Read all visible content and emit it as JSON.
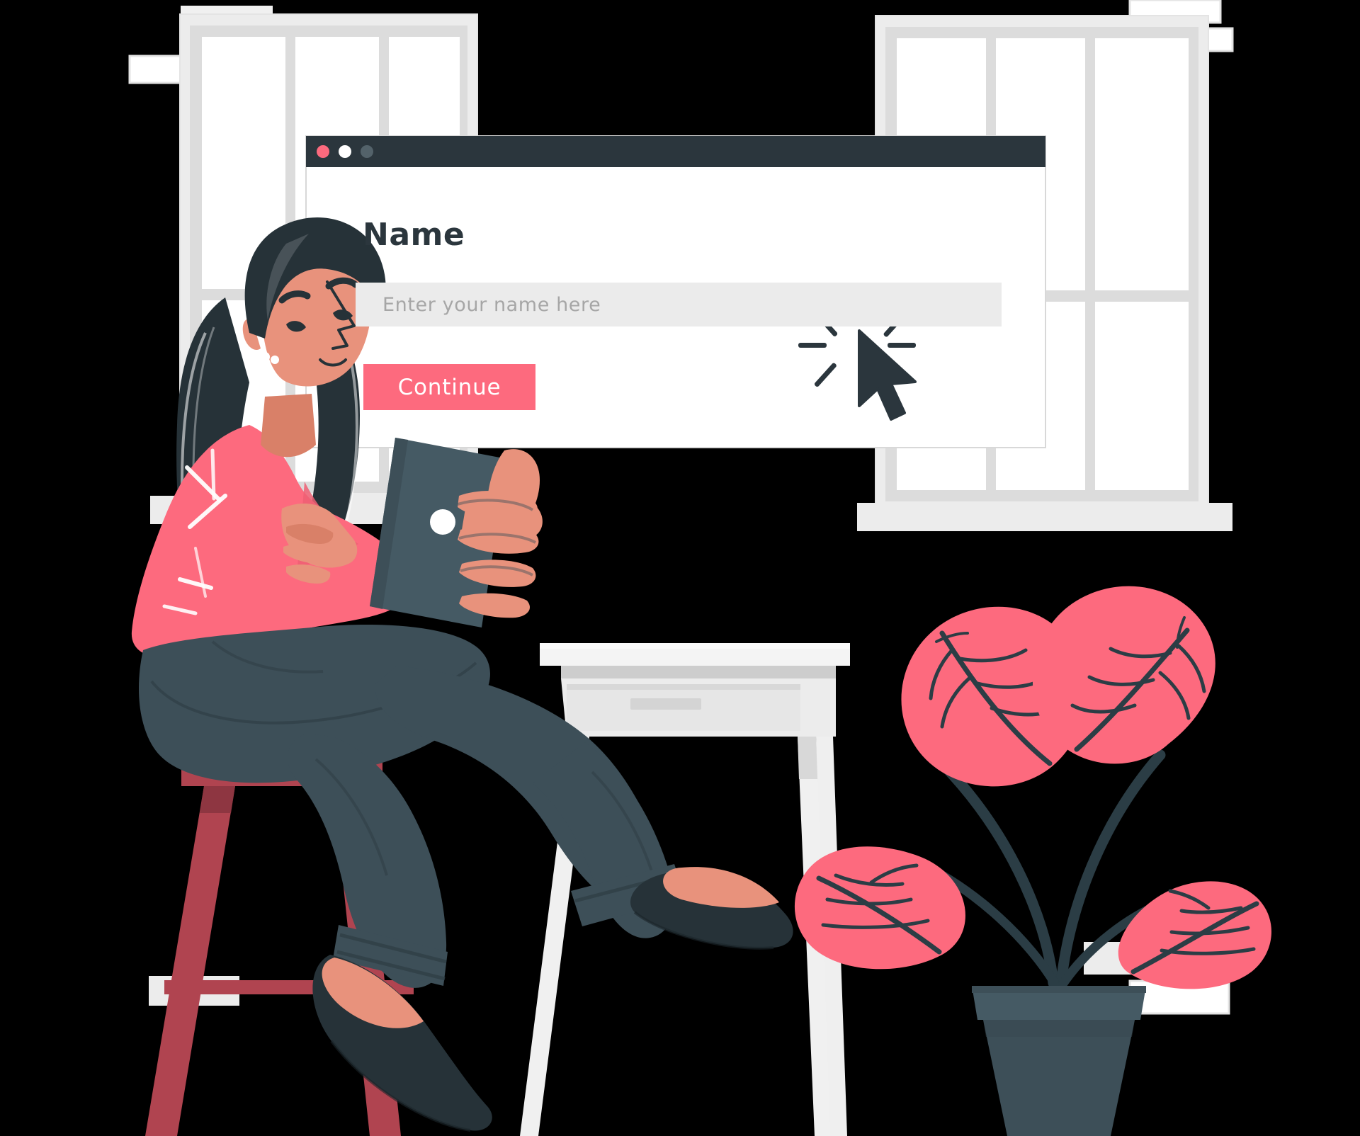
{
  "scene": {
    "description": "Flat vector illustration of a woman sitting on a stool holding a tablet in front of a large browser window mockup with a name form",
    "background": "transparent"
  },
  "browser_window": {
    "titlebar": {
      "color": "#2b363d",
      "dots": [
        {
          "name": "close-dot",
          "color": "#fd6a7e"
        },
        {
          "name": "minimize-dot",
          "color": "#ffffff"
        },
        {
          "name": "maximize-dot",
          "color": "#53626a"
        }
      ]
    },
    "body_color": "#ffffff",
    "form": {
      "label": "Name",
      "input": {
        "value": "",
        "placeholder": "Enter your name here",
        "background": "#ebebeb",
        "text_color": "#a6a6a6"
      },
      "submit": {
        "label": "Continue",
        "background": "#fd6a7e",
        "text_color": "#ffffff"
      }
    },
    "cursor": {
      "icon": "click-cursor-icon",
      "color": "#2b363d",
      "rays": 6
    }
  },
  "background_windows": [
    {
      "name": "left-window",
      "frame_color": "#e8e8e8",
      "pane_color": "#ffffff",
      "mullion_color": "#dcdcdc",
      "panes": 3
    },
    {
      "name": "right-window",
      "frame_color": "#e8e8e8",
      "pane_color": "#ffffff",
      "mullion_color": "#dcdcdc",
      "panes": 3
    }
  ],
  "character": {
    "name": "woman-illustration",
    "hair_color": "#263238",
    "skin_color": "#e8927c",
    "skin_shadow": "#d98068",
    "shirt_color": "#fd6a7e",
    "shirt_highlight": "#ffffff",
    "pants_color": "#3d4f58",
    "pants_shadow": "#35454d",
    "shoe_color": "#263238",
    "earring_color": "#ffffff",
    "holding": {
      "name": "tablet-device",
      "body_color": "#455a64",
      "edge_color": "#37474f",
      "home_button_color": "#ffffff"
    }
  },
  "furniture": {
    "stool": {
      "name": "stool",
      "seat_color": "#b04450",
      "leg_color": "#b04450",
      "leg_shadow": "#8e3641",
      "top_color": "#3d4f58"
    },
    "desk": {
      "name": "desk",
      "top_color": "#f2f2f2",
      "edge_color": "#c8c8c8",
      "drawer_color": "#ebebeb",
      "handle_color": "#d4d4d4",
      "leg_color": "#f0f0f0"
    }
  },
  "plant": {
    "name": "potted-plant",
    "leaf_color": "#fd6a7e",
    "stem_color": "#2b3d45",
    "pot_color": "#3d4f58",
    "pot_rim_color": "#455a64",
    "leaf_count": 4
  },
  "palette": {
    "accent_pink": "#fd6a7e",
    "dark_slate": "#2b363d",
    "pants_slate": "#3d4f58",
    "skin": "#e8927c",
    "stool_red": "#b04450",
    "light_gray": "#ebebeb",
    "frame_gray": "#e8e8e8",
    "white": "#ffffff"
  }
}
